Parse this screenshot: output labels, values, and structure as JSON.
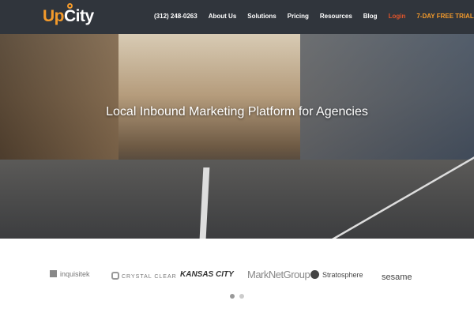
{
  "header": {
    "logo_up": "Up",
    "logo_city": "City",
    "nav": [
      {
        "label": "(312) 248-0263"
      },
      {
        "label": "About Us"
      },
      {
        "label": "Solutions"
      },
      {
        "label": "Pricing"
      },
      {
        "label": "Resources"
      },
      {
        "label": "Blog"
      },
      {
        "label": "Login"
      },
      {
        "label": "7-DAY FREE TRIAL"
      }
    ]
  },
  "hero": {
    "title": "Local Inbound Marketing Platform for Agencies"
  },
  "clients": [
    "inquisitek",
    "CRYSTAL CLEAR",
    "KANSAS CITY",
    "MarkNetGroup",
    "Stratosphere",
    "sesame"
  ],
  "carousel": {
    "pages": 2,
    "active": 1
  },
  "colors": {
    "header": "#30353c",
    "accent": "#f39a2b",
    "login": "#e0542a"
  }
}
